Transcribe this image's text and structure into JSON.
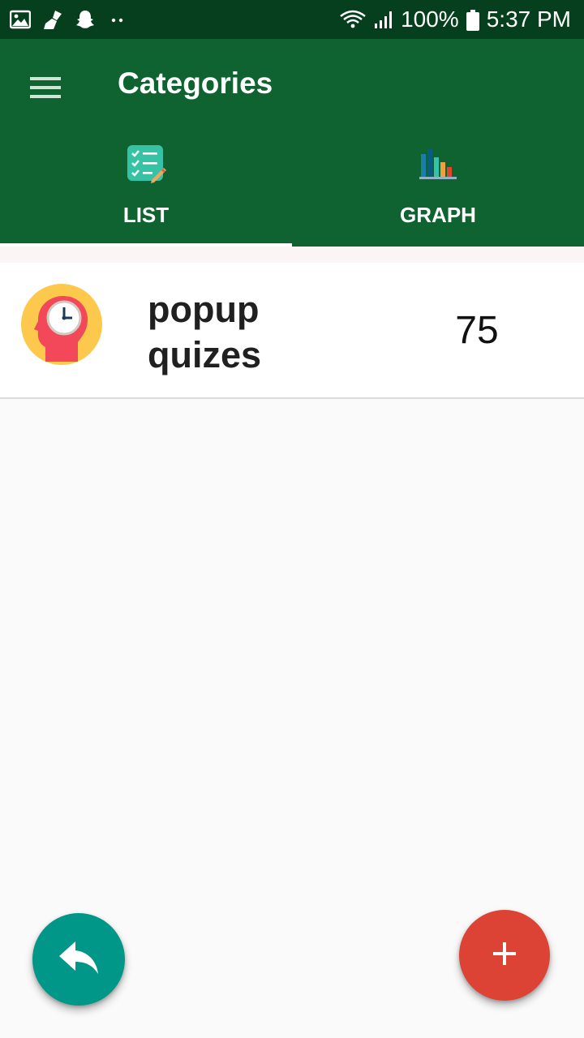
{
  "status_bar": {
    "battery_text": "100%",
    "time": "5:37 PM",
    "icons": [
      "gallery-icon",
      "cleaner-icon",
      "snapchat-icon",
      "more-dots-icon",
      "wifi-icon",
      "signal-icon",
      "battery-icon"
    ]
  },
  "app_bar": {
    "title": "Categories",
    "menu_icon": "hamburger-menu-icon"
  },
  "tabs": [
    {
      "label": "LIST",
      "icon": "checklist-icon",
      "selected": true
    },
    {
      "label": "GRAPH",
      "icon": "bar-graph-icon",
      "selected": false
    }
  ],
  "categories": [
    {
      "name": "popup quizes",
      "count": "75",
      "icon": "head-clock-icon"
    }
  ],
  "fabs": {
    "back_icon": "reply-arrow-icon",
    "add_label": "+"
  },
  "colors": {
    "status_bar": "#063f1d",
    "app_bar": "#0e6330",
    "fab_back": "#009688",
    "fab_add": "#dd4335",
    "avatar_bg": "#fdc94c",
    "avatar_head": "#f3475a"
  }
}
